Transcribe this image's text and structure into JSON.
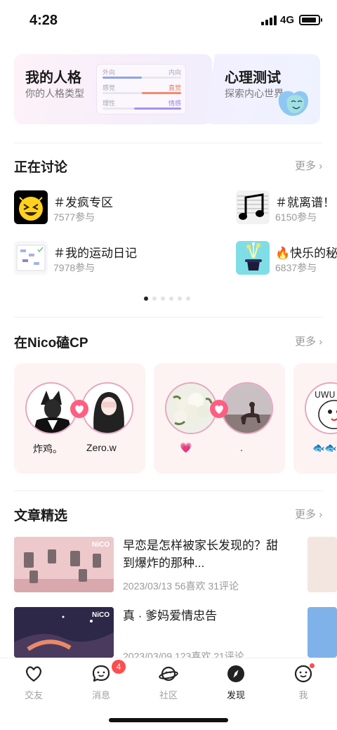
{
  "status_bar": {
    "time": "4:28",
    "network": "4G"
  },
  "personality_card": {
    "title": "我的人格",
    "subtitle": "你的人格类型",
    "meter": [
      {
        "left": "外向",
        "right": "内向",
        "value": 0.5,
        "color": "#8ea2f0",
        "side": "left"
      },
      {
        "left": "感觉",
        "right": "直觉",
        "value": 0.5,
        "color": "#f08c6e",
        "side": "right"
      },
      {
        "left": "理性",
        "right": "情感",
        "value": 0.6,
        "color": "#a493ee",
        "side": "right"
      }
    ]
  },
  "psych_card": {
    "title": "心理测试",
    "subtitle": "探索内心世界",
    "icon": "smiling-mask-icon"
  },
  "discussion": {
    "title": "正在讨论",
    "more": "更多",
    "topics": [
      {
        "name": "＃发疯专区",
        "count": "7577参与",
        "icon": "crazy-face-icon"
      },
      {
        "name": "＃就离谱！",
        "count": "6150参与",
        "icon": "music-note-icon"
      },
      {
        "name": "＃我的运动日记",
        "count": "7978参与",
        "icon": "planner-icon"
      },
      {
        "name": "🔥快乐的秘",
        "count": "6837参与",
        "icon": "magic-hat-icon"
      }
    ],
    "page_count": 6,
    "active_page": 0
  },
  "cp": {
    "title": "在Nico磕CP",
    "more": "更多",
    "pairs": [
      {
        "a": "炸鸡。",
        "b": "Zero.w"
      },
      {
        "a": "💗",
        "b": "."
      },
      {
        "a": "🐟🐟",
        "b": ""
      }
    ]
  },
  "articles": {
    "title": "文章精选",
    "more": "更多",
    "items": [
      {
        "title": "早恋是怎样被家长发现的？甜到爆炸的那种...",
        "meta": "2023/03/13  56喜欢  31评论",
        "tag": "NiCO"
      },
      {
        "title": "真 · 爹妈爱情忠告",
        "meta": "2023/03/09  123喜欢  21评论",
        "tag": "NiCO"
      }
    ]
  },
  "tabbar": {
    "tabs": [
      {
        "label": "交友",
        "icon": "heart-icon"
      },
      {
        "label": "消息",
        "icon": "chat-bubble-icon"
      },
      {
        "label": "社区",
        "icon": "planet-icon"
      },
      {
        "label": "发现",
        "icon": "compass-icon"
      },
      {
        "label": "我",
        "icon": "smiley-icon"
      }
    ],
    "active": "发现",
    "message_badge": "4"
  },
  "colors": {
    "accent": "#ff5e82",
    "badge": "#ff4d4f"
  }
}
